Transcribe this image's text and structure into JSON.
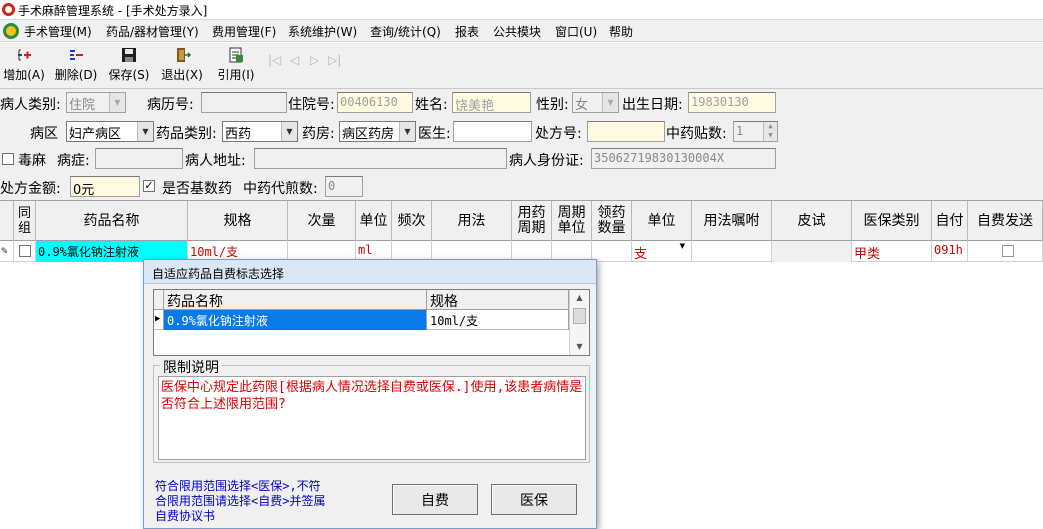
{
  "window": {
    "title": "手术麻醉管理系统 - [手术处方录入]"
  },
  "menu": [
    "手术管理(M)",
    "药品/器材管理(Y)",
    "费用管理(F)",
    "系统维护(W)",
    "查询/统计(Q)",
    "报表",
    "公共模块",
    "窗口(U)",
    "帮助"
  ],
  "toolbar": {
    "add": "增加(A)",
    "delete": "删除(D)",
    "save": "保存(S)",
    "exit": "退出(X)",
    "cite": "引用(I)",
    "nav": [
      "|◁",
      "◁",
      "▷",
      "▷|"
    ]
  },
  "form": {
    "patient_type": {
      "label": "病人类别:",
      "value": "住院"
    },
    "record_no": {
      "label": "病历号:",
      "value": ""
    },
    "inpatient_no": {
      "label": "住院号:",
      "value": "00406130"
    },
    "name": {
      "label": "姓名:",
      "value": "饶美艳"
    },
    "gender": {
      "label": "性别:",
      "value": "女"
    },
    "birth_date": {
      "label": "出生日期:",
      "value": "19830130"
    },
    "ward": {
      "label": "病区",
      "value": "妇产病区"
    },
    "drug_category": {
      "label": "药品类别:",
      "value": "西药"
    },
    "pharmacy": {
      "label": "药房:",
      "value": "病区药房"
    },
    "doctor": {
      "label": "医生:",
      "value": ""
    },
    "rx_no": {
      "label": "处方号:",
      "value": ""
    },
    "tcm_doses": {
      "label": "中药贴数:",
      "value": "1"
    },
    "poison": {
      "label": "毒麻",
      "checked": false
    },
    "disease": {
      "label": "病症:",
      "value": ""
    },
    "address": {
      "label": "病人地址:",
      "value": ""
    },
    "id_card": {
      "label": "病人身份证:",
      "value": "350627198301300​04X"
    },
    "amount": {
      "label": "处方金额:",
      "value": "0元"
    },
    "basic_drug": {
      "label": "是否基数药",
      "checked": true
    },
    "tcm_decoct": {
      "label": "中药代煎数:",
      "value": "0"
    }
  },
  "grid": {
    "columns": [
      "同组",
      "药品名称",
      "规格",
      "次量",
      "单位",
      "频次",
      "用法",
      "用药周期",
      "周期单位",
      "领药数量",
      "单位",
      "用法嘱咐",
      "皮试",
      "医保类别",
      "自付",
      "自费发送"
    ],
    "row": {
      "drug": "0.9%氯化钠注射液",
      "spec": "10ml/支",
      "unit": "ml",
      "dispense_unit": "支",
      "insurance": "甲类",
      "self_pay": "091h"
    }
  },
  "dialog": {
    "title": "自适应药品自费标志选择",
    "list_headers": [
      "药品名称",
      "规格"
    ],
    "list_row": {
      "name": "0.9%氯化钠注射液",
      "spec": "10ml/支"
    },
    "restriction_label": "限制说明",
    "restriction_text": "医保中心规定此药限[根据病人情况选择自费或医保.]使用,该患者病情是否符合上述限用范围?",
    "note": "符合限用范围选择<医保>,不符\n合限用范围请选择<自费>并签属\n自费协议书",
    "btn_self_pay": "自费",
    "btn_insurance": "医保"
  },
  "colors": {
    "selection": "#0a7ae8",
    "cell_highlight": "#00ffff",
    "warn_text": "#e00000",
    "note_text": "#0000cc"
  }
}
